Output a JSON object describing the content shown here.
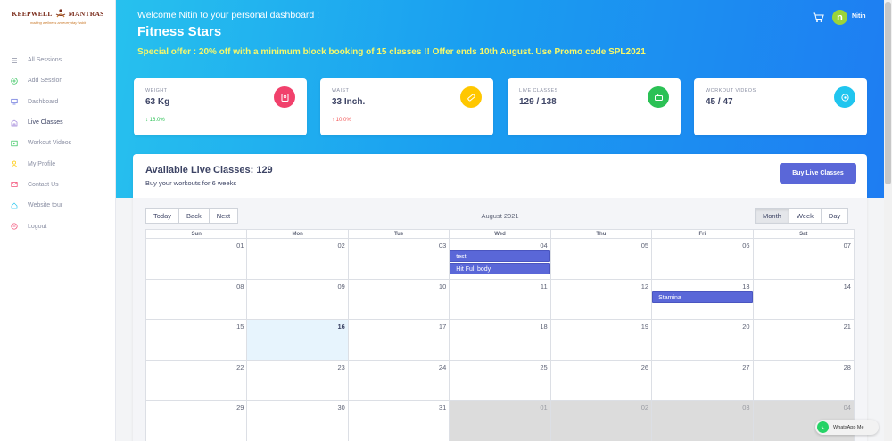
{
  "brand": {
    "name_left": "KEEPWELL",
    "name_right": "MANTRAS",
    "tagline": "making wellness an everyday habit"
  },
  "sidebar": {
    "items": [
      {
        "label": "All Sessions",
        "icon": "list-icon"
      },
      {
        "label": "Add Session",
        "icon": "plus-circle-icon"
      },
      {
        "label": "Dashboard",
        "icon": "monitor-icon"
      },
      {
        "label": "Live Classes",
        "icon": "classes-icon"
      },
      {
        "label": "Workout Videos",
        "icon": "video-icon"
      },
      {
        "label": "My Profile",
        "icon": "user-icon"
      },
      {
        "label": "Contact Us",
        "icon": "contact-icon"
      },
      {
        "label": "Website tour",
        "icon": "tour-icon"
      },
      {
        "label": "Logout",
        "icon": "logout-icon"
      }
    ]
  },
  "header": {
    "welcome": "Welcome Nitin to your personal dashboard !",
    "title": "Fitness Stars",
    "offer": "Special offer : 20% off with a minimum block booking of 15 classes !! Offer ends 10th August. Use Promo code SPL2021",
    "user_initial": "n",
    "user_name": "Nitin"
  },
  "stats": [
    {
      "label": "WEIGHT",
      "value": "63 Kg",
      "change": "16.0%",
      "direction": "down",
      "color": "#f1416c",
      "icon": "scale-icon"
    },
    {
      "label": "WAIST",
      "value": "33 Inch.",
      "change": "10.0%",
      "direction": "up",
      "color": "#ffc700",
      "icon": "tape-icon"
    },
    {
      "label": "LIVE CLASSES",
      "value": "129 / 138",
      "change": "",
      "direction": "",
      "color": "#2bc155",
      "icon": "camera-icon"
    },
    {
      "label": "WORKOUT VIDEOS",
      "value": "45 / 47",
      "change": "",
      "direction": "",
      "color": "#20c5ef",
      "icon": "target-icon"
    }
  ],
  "panel": {
    "title": "Available Live Classes: 129",
    "subtitle": "Buy your workouts for 6 weeks",
    "buy_label": "Buy Live Classes"
  },
  "calendar": {
    "nav": [
      "Today",
      "Back",
      "Next"
    ],
    "label": "August 2021",
    "views": [
      "Month",
      "Week",
      "Day"
    ],
    "active_view": "Month",
    "weekdays": [
      "Sun",
      "Mon",
      "Tue",
      "Wed",
      "Thu",
      "Fri",
      "Sat"
    ],
    "weeks": [
      [
        "01",
        "02",
        "03",
        "04",
        "05",
        "06",
        "07"
      ],
      [
        "08",
        "09",
        "10",
        "11",
        "12",
        "13",
        "14"
      ],
      [
        "15",
        "16",
        "17",
        "18",
        "19",
        "20",
        "21"
      ],
      [
        "22",
        "23",
        "24",
        "25",
        "26",
        "27",
        "28"
      ],
      [
        "29",
        "30",
        "31",
        "01",
        "02",
        "03",
        "04"
      ]
    ],
    "today": "16",
    "events": [
      {
        "title": "test",
        "date": "04"
      },
      {
        "title": "Hit Full body",
        "date": "04"
      },
      {
        "title": "Stamina",
        "date": "13"
      }
    ]
  },
  "whatsapp": {
    "label": "WhatsApp Me"
  }
}
